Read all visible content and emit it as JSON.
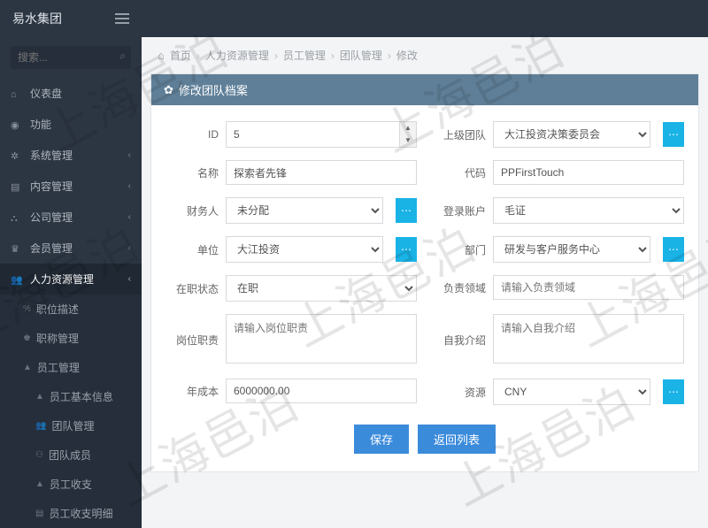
{
  "brand": "易水集团",
  "search_placeholder": "搜索...",
  "breadcrumb": [
    "首页",
    "人力资源管理",
    "员工管理",
    "团队管理",
    "修改"
  ],
  "panel_title": "修改团队档案",
  "sidebar": {
    "items": [
      {
        "label": "仪表盘"
      },
      {
        "label": "功能"
      },
      {
        "label": "系统管理"
      },
      {
        "label": "内容管理"
      },
      {
        "label": "公司管理"
      },
      {
        "label": "会员管理"
      },
      {
        "label": "人力资源管理"
      }
    ],
    "sub": [
      {
        "label": "职位描述"
      },
      {
        "label": "职称管理"
      },
      {
        "label": "员工管理"
      }
    ],
    "sub2": [
      {
        "label": "员工基本信息"
      },
      {
        "label": "团队管理"
      },
      {
        "label": "团队成员"
      },
      {
        "label": "员工收支"
      },
      {
        "label": "员工收支明细"
      }
    ]
  },
  "form": {
    "id_label": "ID",
    "id_value": "5",
    "parent_label": "上级团队",
    "parent_value": "大江投资决策委员会",
    "name_label": "名称",
    "name_value": "探索者先锋",
    "code_label": "代码",
    "code_value": "PPFirstTouch",
    "finance_label": "财务人",
    "finance_value": "未分配",
    "login_label": "登录账户",
    "login_value": "毛证",
    "unit_label": "单位",
    "unit_value": "大江投资",
    "dept_label": "部门",
    "dept_value": "研发与客户服务中心",
    "status_label": "在职状态",
    "status_value": "在职",
    "domain_label": "负责领域",
    "domain_placeholder": "请输入负责领域",
    "duty_label": "岗位职责",
    "duty_placeholder": "请输入岗位职责",
    "intro_label": "自我介绍",
    "intro_placeholder": "请输入自我介绍",
    "cost_label": "年成本",
    "cost_value": "6000000.00",
    "currency_label": "资源",
    "currency_value": "CNY"
  },
  "buttons": {
    "save": "保存",
    "back": "返回列表"
  },
  "watermark": "上海邑泊"
}
